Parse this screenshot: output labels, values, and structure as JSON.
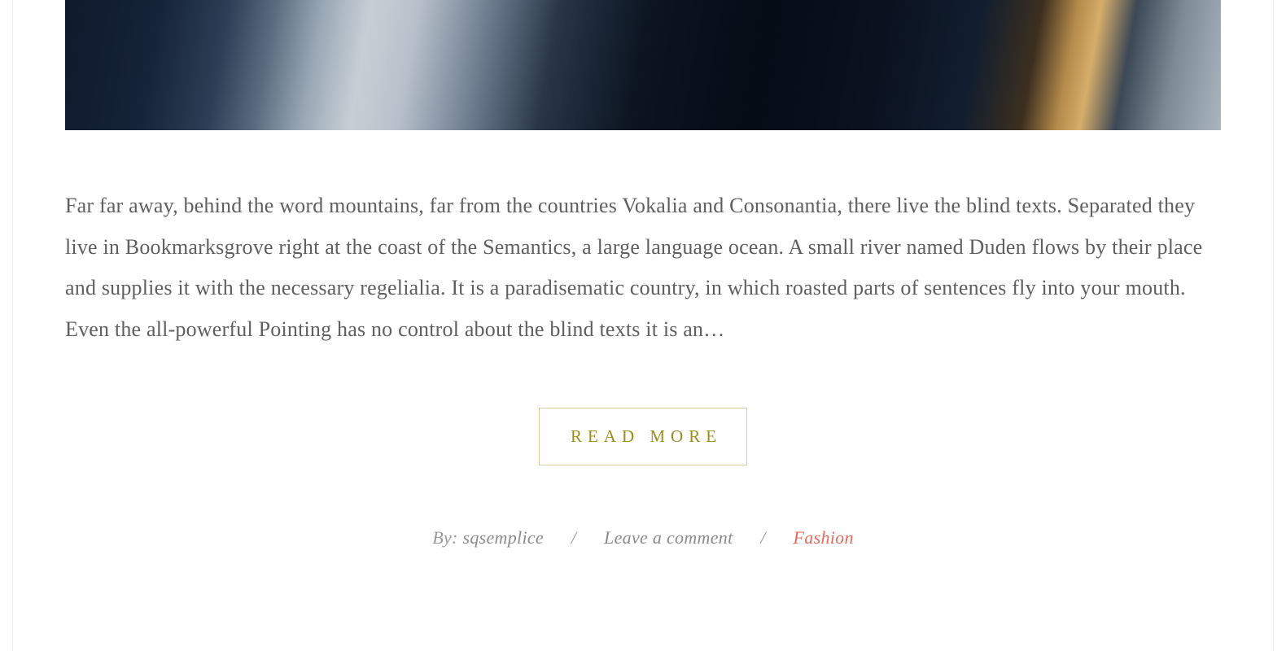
{
  "post": {
    "excerpt": "Far far away, behind the word mountains, far from the countries Vokalia and Consonantia, there live the blind texts. Separated they live in Bookmarksgrove right at the coast of the Semantics, a large language ocean. A small river named Duden flows by their place and supplies it with the necessary regelialia. It is a paradisematic country, in which roasted parts of sentences fly into your mouth. Even the all-powerful Pointing has no control about the blind texts it is an…",
    "read_more_label": "READ MORE",
    "meta": {
      "by_label": "By: ",
      "author": "sqsemplice",
      "separator": "/",
      "comment_label": "Leave a comment",
      "category": "Fashion"
    }
  }
}
